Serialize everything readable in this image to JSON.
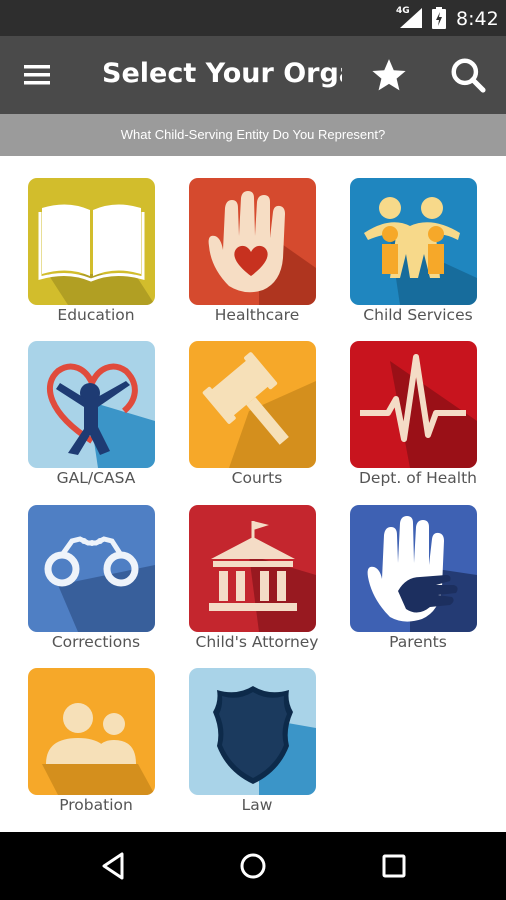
{
  "status_bar": {
    "network": "4G",
    "time": "8:42"
  },
  "app_bar": {
    "title": "Select Your Orga..."
  },
  "subheader": {
    "text": "What Child-Serving Entity Do You Represent?"
  },
  "organizations": [
    {
      "label": "Education",
      "icon": "book-icon",
      "color": "#d2bd2c"
    },
    {
      "label": "Healthcare",
      "icon": "hand-heart-icon",
      "color": "#d54a2e"
    },
    {
      "label": "Child Services",
      "icon": "family-icon",
      "color": "#1f86bf"
    },
    {
      "label": "GAL/CASA",
      "icon": "child-heart-icon",
      "color": "#a9d3e8"
    },
    {
      "label": "Courts",
      "icon": "gavel-icon",
      "color": "#f6a829"
    },
    {
      "label": "Dept. of Health",
      "icon": "heartbeat-icon",
      "color": "#c8141e"
    },
    {
      "label": "Corrections",
      "icon": "handcuffs-icon",
      "color": "#4f7fc4"
    },
    {
      "label": "Child's Attorney",
      "icon": "courthouse-icon",
      "color": "#c4262e"
    },
    {
      "label": "Parents",
      "icon": "hands-icon",
      "color": "#3e61b3"
    },
    {
      "label": "Probation",
      "icon": "people-icon",
      "color": "#f6a829"
    },
    {
      "label": "Law",
      "icon": "badge-icon",
      "color": "#a9d3e8"
    }
  ]
}
